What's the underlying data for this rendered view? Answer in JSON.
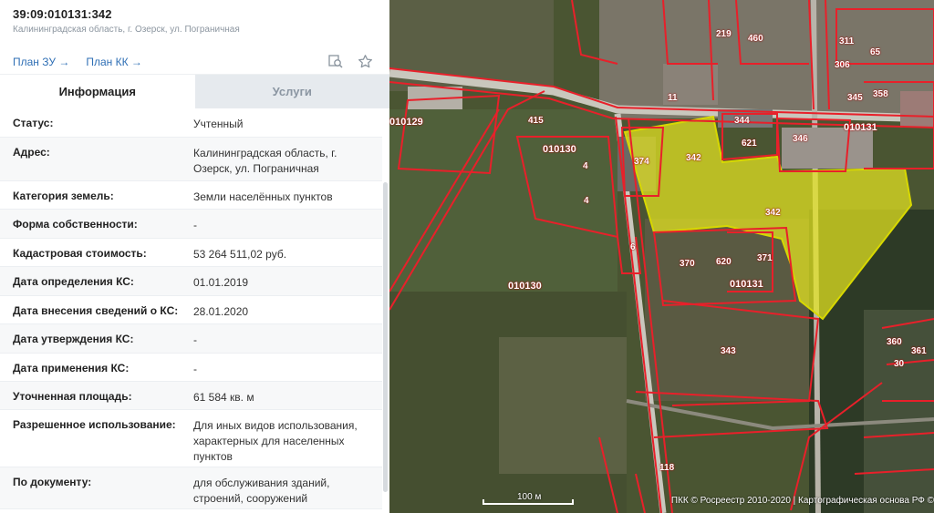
{
  "header": {
    "cadastral_number": "39:09:010131:342",
    "address_short": "Калининградская область, г. Озерск, ул. Пограничная",
    "links": [
      "План ЗУ →",
      "План КК →"
    ]
  },
  "tabs": [
    {
      "label": "Информация",
      "active": true
    },
    {
      "label": "Услуги",
      "active": false
    }
  ],
  "rows": [
    {
      "k": "Статус:",
      "v": "Учтенный"
    },
    {
      "k": "Адрес:",
      "v": "Калининградская область, г. Озерск, ул. Пограничная"
    },
    {
      "k": "Категория земель:",
      "v": "Земли населённых пунктов"
    },
    {
      "k": "Форма собственности:",
      "v": "-"
    },
    {
      "k": "Кадастровая стоимость:",
      "v": "53 264 511,02 руб."
    },
    {
      "k": "Дата определения КС:",
      "v": "01.01.2019"
    },
    {
      "k": "Дата внесения сведений о КС:",
      "v": "28.01.2020"
    },
    {
      "k": "Дата утверждения КС:",
      "v": "-"
    },
    {
      "k": "Дата применения КС:",
      "v": "-"
    },
    {
      "k": "Уточненная площадь:",
      "v": "61 584 кв. м"
    },
    {
      "k": "Разрешенное использование:",
      "v": "Для иных видов использования, характерных для населенных пунктов"
    },
    {
      "k": "По документу:",
      "v": "для обслуживания зданий, строений, сооружений"
    }
  ],
  "map": {
    "quarters": [
      "010129",
      "010130",
      "010130",
      "010131",
      "010131"
    ],
    "parcels": [
      "342",
      "342",
      "374",
      "344",
      "621",
      "346",
      "370",
      "620",
      "371",
      "343",
      "11",
      "460",
      "219",
      "311",
      "306",
      "65",
      "345",
      "358",
      "415",
      "4",
      "4",
      "6",
      "118",
      "360",
      "361",
      "30"
    ],
    "scale_label": "100 м",
    "copyright": "ПКК © Росреестр 2010-2020 | Картографическая основа РФ ©"
  },
  "colors": {
    "link": "#2f6fb5",
    "parcel_border": "#e8202a",
    "selected_fill": "#e6e620"
  },
  "icons": [
    "map-search-icon",
    "star-icon"
  ]
}
